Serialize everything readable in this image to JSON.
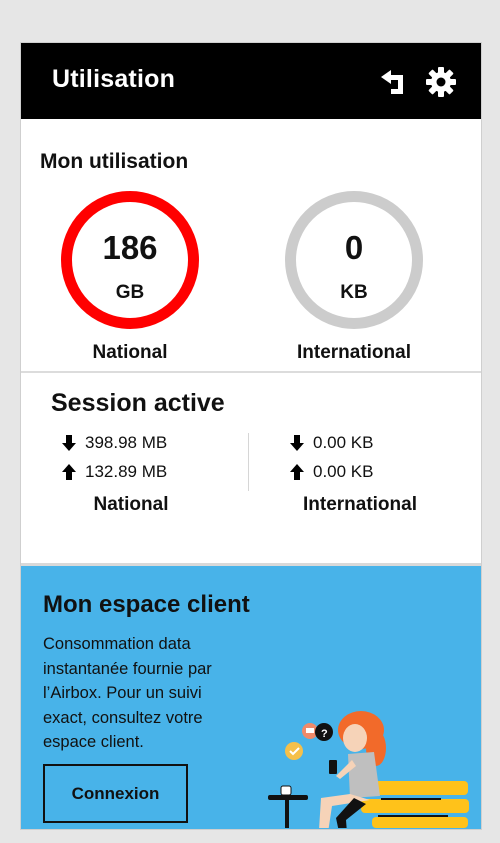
{
  "header": {
    "title": "Utilisation",
    "icons": [
      "back-icon",
      "gear-icon"
    ]
  },
  "usage": {
    "title": "Mon utilisation",
    "national": {
      "value": "186",
      "unit": "GB",
      "label": "National",
      "ring_color": "#ff0000"
    },
    "international": {
      "value": "0",
      "unit": "KB",
      "label": "International",
      "ring_color": "#cccccc"
    }
  },
  "session": {
    "title": "Session active",
    "national": {
      "download": "398.98 MB",
      "upload": "132.89 MB",
      "label": "National"
    },
    "international": {
      "download": "0.00 KB",
      "upload": "0.00 KB",
      "label": "International"
    }
  },
  "promo": {
    "title": "Mon espace client",
    "text_lines": [
      "Consommation data",
      "instantanée fournie par",
      "l’Airbox. Pour un suivi",
      "exact, consultez votre",
      "espace client."
    ],
    "button_label": "Connexion",
    "background_color": "#48b3e9"
  }
}
